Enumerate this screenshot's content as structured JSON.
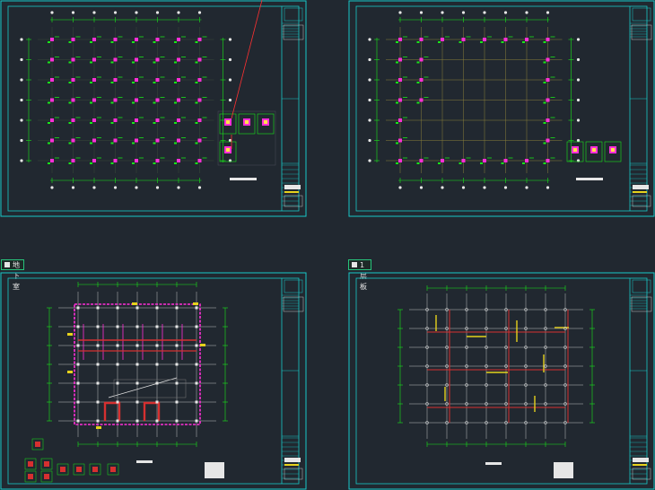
{
  "sheets": [
    {
      "id": "sheet-1",
      "tab_label": ""
    },
    {
      "id": "sheet-2",
      "tab_label": ""
    },
    {
      "id": "sheet-3",
      "tab_label": "地下室"
    },
    {
      "id": "sheet-4",
      "tab_label": "1层板"
    }
  ],
  "colors": {
    "background": "#212830",
    "frame": "#18c8c8",
    "grid_line": "#8a7f3a",
    "column": "#ff2fd8",
    "annotation": "#19e619",
    "wall": "#ff2fd8",
    "beam_red": "#d63030",
    "beam_yellow": "#e6d21c",
    "pointer": "#ff3030",
    "white": "#e6e6e6"
  }
}
